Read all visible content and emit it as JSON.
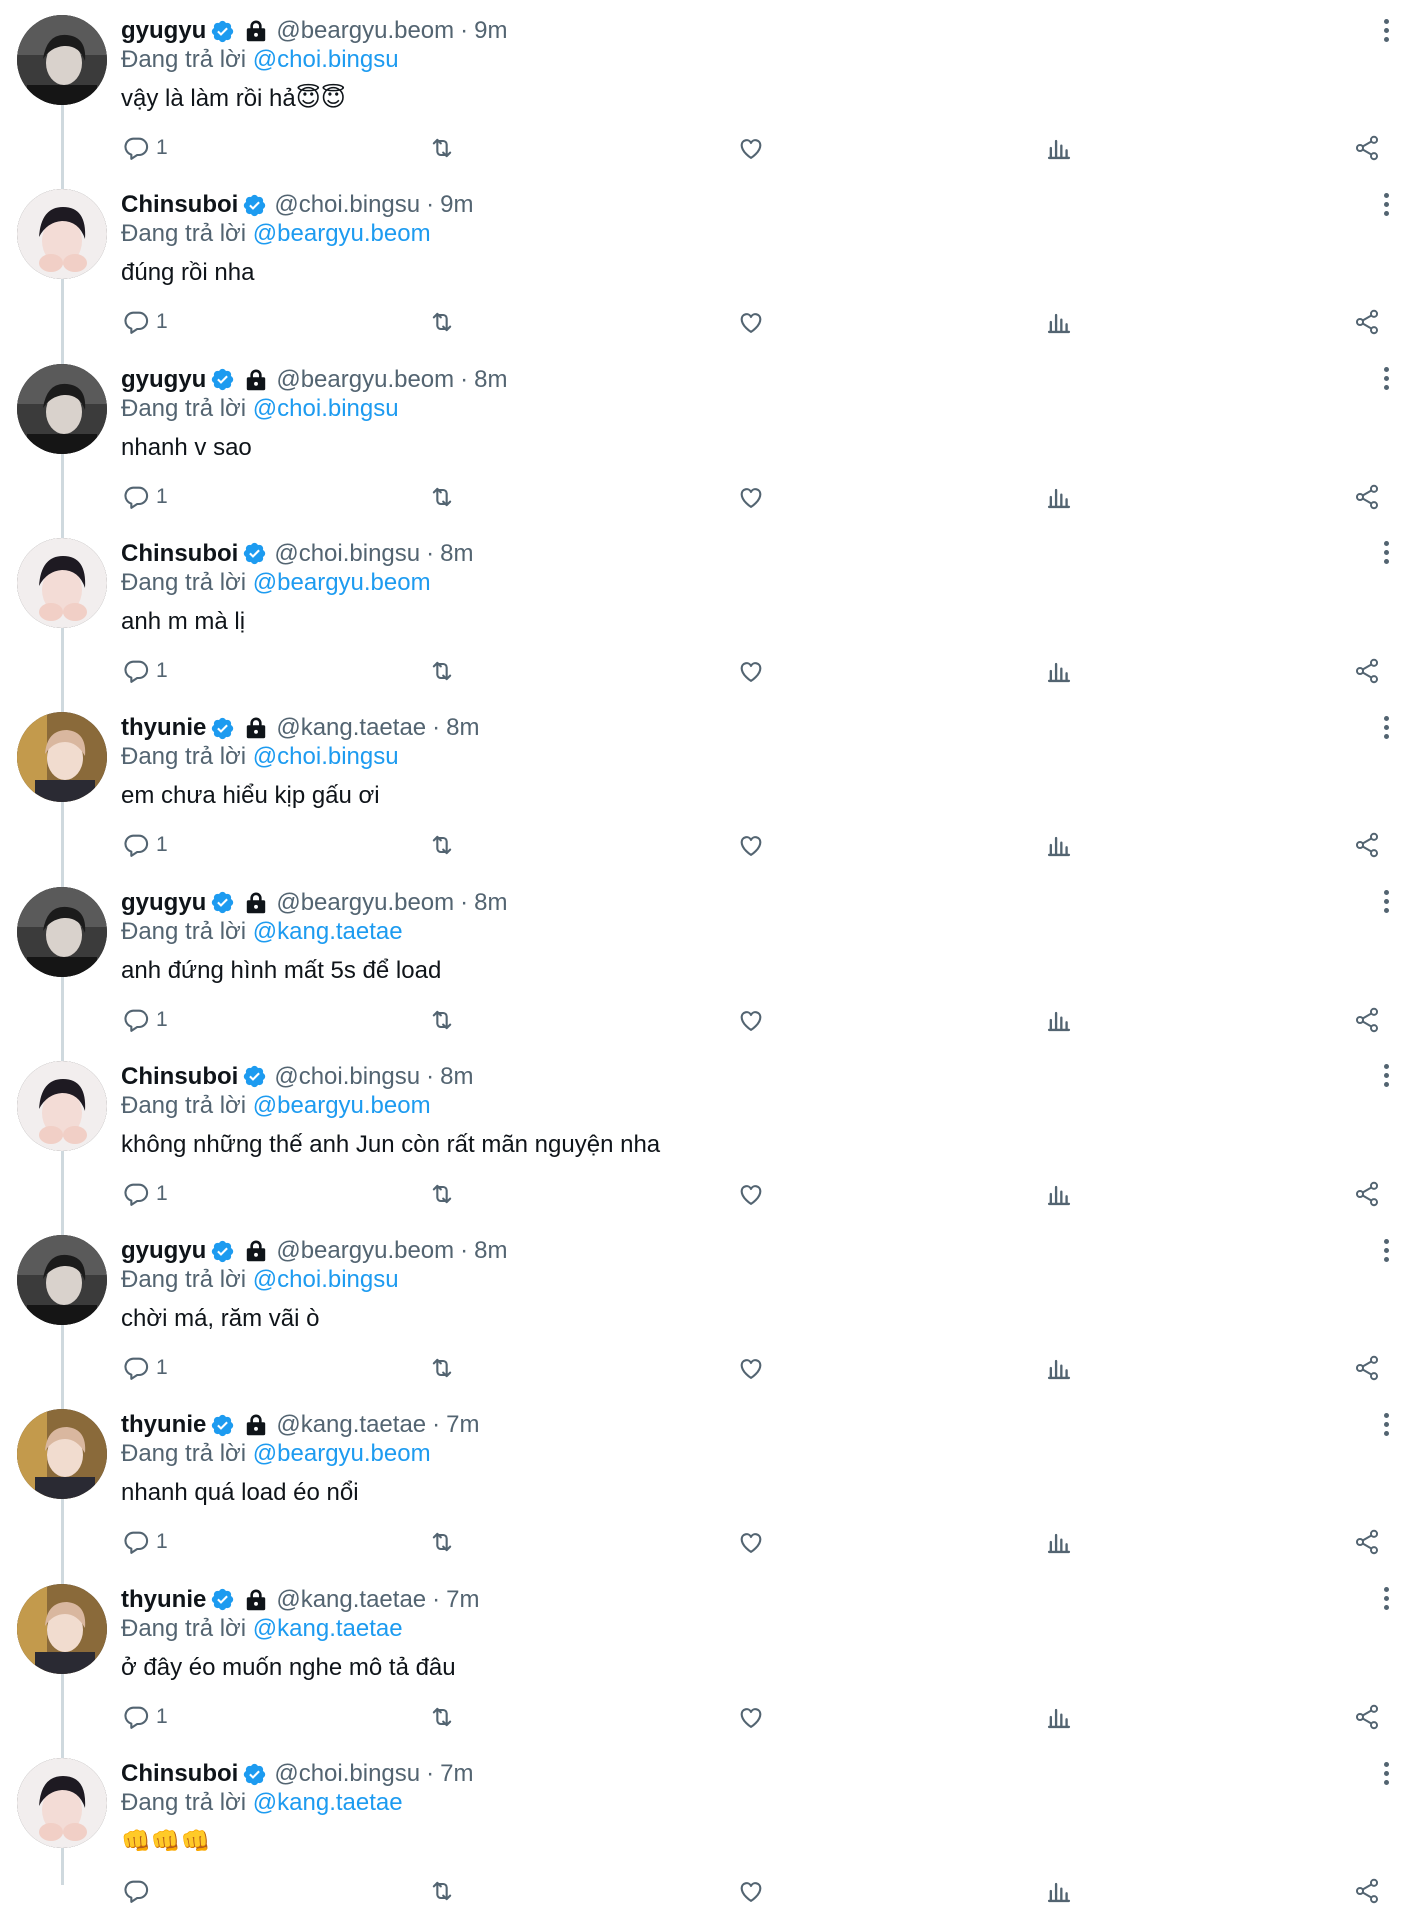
{
  "replying_prefix": "Đang trả lời",
  "tweets": [
    {
      "name": "gyugyu",
      "protected": true,
      "handle": "@beargyu.beom",
      "time": "9m",
      "replying_to": "@choi.bingsu",
      "text": "vậy là làm rồi hả",
      "emoji": "😇😇",
      "reply_count": "1",
      "avatar": "gyugyu"
    },
    {
      "name": "Chinsuboi",
      "protected": false,
      "handle": "@choi.bingsu",
      "time": "9m",
      "replying_to": "@beargyu.beom",
      "text": "đúng rồi nha",
      "emoji": "",
      "reply_count": "1",
      "avatar": "chinsuboi"
    },
    {
      "name": "gyugyu",
      "protected": true,
      "handle": "@beargyu.beom",
      "time": "8m",
      "replying_to": "@choi.bingsu",
      "text": "nhanh v sao",
      "emoji": "",
      "reply_count": "1",
      "avatar": "gyugyu"
    },
    {
      "name": "Chinsuboi",
      "protected": false,
      "handle": "@choi.bingsu",
      "time": "8m",
      "replying_to": "@beargyu.beom",
      "text": "anh m mà lị",
      "emoji": "",
      "reply_count": "1",
      "avatar": "chinsuboi"
    },
    {
      "name": "thyunie",
      "protected": true,
      "handle": "@kang.taetae",
      "time": "8m",
      "replying_to": "@choi.bingsu",
      "text": "em chưa hiểu kịp gấu ơi",
      "emoji": "",
      "reply_count": "1",
      "avatar": "thyunie"
    },
    {
      "name": "gyugyu",
      "protected": true,
      "handle": "@beargyu.beom",
      "time": "8m",
      "replying_to": "@kang.taetae",
      "text": "anh đứng hình mất 5s để load",
      "emoji": "",
      "reply_count": "1",
      "avatar": "gyugyu"
    },
    {
      "name": "Chinsuboi",
      "protected": false,
      "handle": "@choi.bingsu",
      "time": "8m",
      "replying_to": "@beargyu.beom",
      "text": "không những thế anh Jun còn rất  mãn nguyện nha",
      "emoji": "",
      "reply_count": "1",
      "avatar": "chinsuboi"
    },
    {
      "name": "gyugyu",
      "protected": true,
      "handle": "@beargyu.beom",
      "time": "8m",
      "replying_to": "@choi.bingsu",
      "text": "chời má, răm vãi ò",
      "emoji": "",
      "reply_count": "1",
      "avatar": "gyugyu"
    },
    {
      "name": "thyunie",
      "protected": true,
      "handle": "@kang.taetae",
      "time": "7m",
      "replying_to": "@beargyu.beom",
      "text": "nhanh quá load éo nổi",
      "emoji": "",
      "reply_count": "1",
      "avatar": "thyunie"
    },
    {
      "name": "thyunie",
      "protected": true,
      "handle": "@kang.taetae",
      "time": "7m",
      "replying_to": "@kang.taetae",
      "text": "ở đây éo muốn nghe mô tả đâu",
      "emoji": "",
      "reply_count": "1",
      "avatar": "thyunie"
    },
    {
      "name": "Chinsuboi",
      "protected": false,
      "handle": "@choi.bingsu",
      "time": "7m",
      "replying_to": "@kang.taetae",
      "text": "",
      "emoji": "👊👊👊",
      "reply_count": "",
      "avatar": "chinsuboi"
    }
  ],
  "icons": {
    "reply": "reply-icon",
    "retweet": "retweet-icon",
    "like": "heart-icon",
    "views": "views-icon",
    "share": "share-icon",
    "more": "more-icon",
    "verified": "verified-badge-icon",
    "protected": "lock-icon"
  },
  "colors": {
    "accent": "#1d9bf0",
    "muted": "#536471",
    "text": "#0f1419",
    "thread_line": "#cfd9de"
  }
}
